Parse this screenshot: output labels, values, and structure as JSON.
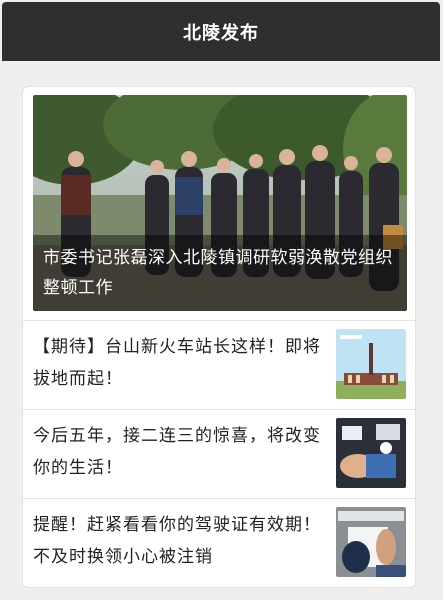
{
  "header": {
    "title": "北陵发布"
  },
  "hero": {
    "caption": "市委书记张磊深入北陵镇调研软弱涣散党组织整顿工作"
  },
  "articles": [
    {
      "title": "【期待】台山新火车站长这样！即将拔地而起！"
    },
    {
      "title": "今后五年，接二连三的惊喜，将改变你的生活！"
    },
    {
      "title": "提醒！赶紧看看你的驾驶证有效期！不及时换领小心被注销"
    }
  ],
  "colors": {
    "header_bg": "#2f2f2f",
    "page_bg": "#efefef",
    "card_bg": "#ffffff"
  }
}
